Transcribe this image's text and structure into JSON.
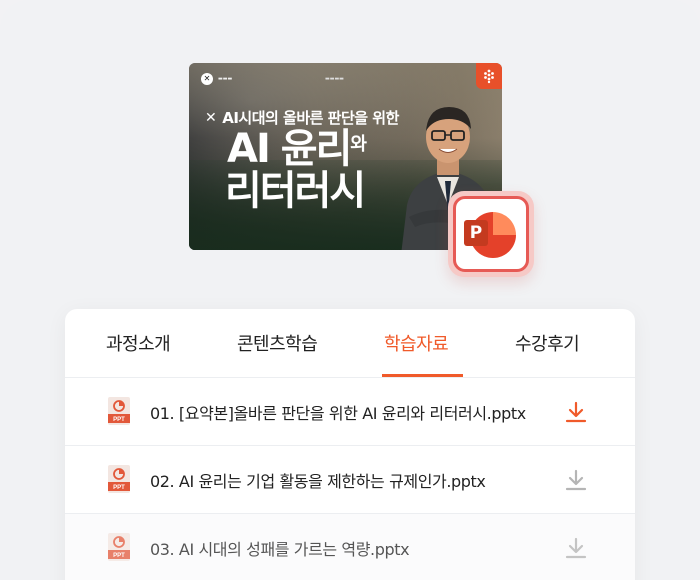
{
  "thumbnail": {
    "headline": "AI시대의 올바른 판단을 위한",
    "title_line1": "AI 윤리",
    "title_line1_suffix": "와",
    "title_line2": "리터러시"
  },
  "app_badge": {
    "icon": "powerpoint-icon",
    "letter": "P"
  },
  "tabs": [
    {
      "label": "과정소개"
    },
    {
      "label": "콘텐츠학습"
    },
    {
      "label": "학습자료",
      "active": true
    },
    {
      "label": "수강후기"
    }
  ],
  "files": [
    {
      "name": "01. [요약본]올바른 판단을 위한 AI 윤리와 리터러시.pptx",
      "type_label": "PPT",
      "download_icon": "download-icon",
      "highlight": true
    },
    {
      "name": "02. AI 윤리는 기업 활동을 제한하는 규제인가.pptx",
      "type_label": "PPT",
      "download_icon": "download-icon"
    },
    {
      "name": "03. AI 시대의 성패를 가르는 역량.pptx",
      "type_label": "PPT",
      "download_icon": "download-icon"
    }
  ],
  "colors": {
    "accent": "#f05a2a",
    "inactive_icon": "#b5b5b5",
    "ppt_red": "#e4412a"
  }
}
